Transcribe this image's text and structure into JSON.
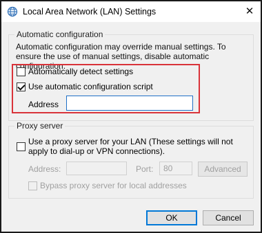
{
  "window": {
    "title": "Local Area Network (LAN) Settings",
    "close_glyph": "✕",
    "icon": "network-globe-icon"
  },
  "auto_config": {
    "group_label": "Automatic configuration",
    "description": "Automatic configuration may override manual settings.  To ensure the use of manual settings, disable automatic configuration.",
    "detect_label": "Automatically detect settings",
    "detect_checked": false,
    "script_label": "Use automatic configuration script",
    "script_checked": true,
    "address_label": "Address",
    "address_value": ""
  },
  "proxy": {
    "group_label": "Proxy server",
    "use_proxy_label": "Use a proxy server for your LAN (These settings will not apply to dial-up or VPN connections).",
    "use_proxy_checked": false,
    "address_label": "Address:",
    "address_value": "",
    "port_label": "Port:",
    "port_value": "80",
    "advanced_label": "Advanced",
    "bypass_label": "Bypass proxy server for local addresses",
    "bypass_checked": false
  },
  "buttons": {
    "ok_label": "OK",
    "cancel_label": "Cancel"
  },
  "colors": {
    "highlight": "#d93239",
    "focus": "#0078d7"
  }
}
